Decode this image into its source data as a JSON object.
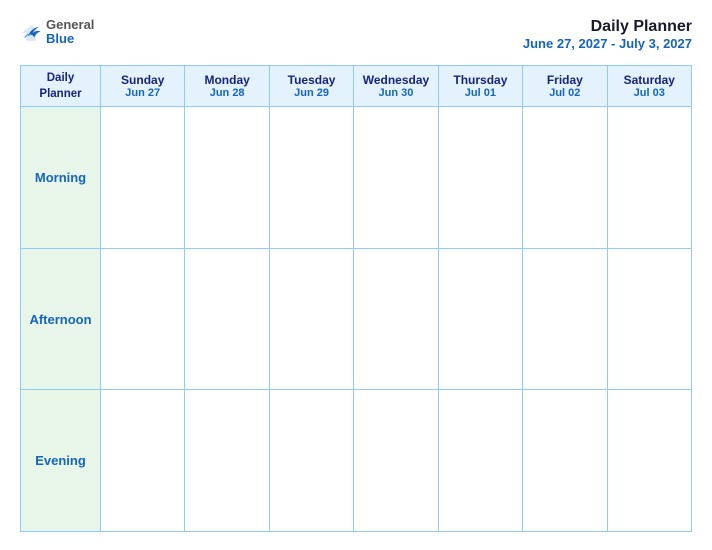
{
  "logo": {
    "general": "General",
    "blue": "Blue",
    "icon_color": "#1565c0"
  },
  "header": {
    "title": "Daily Planner",
    "dates": "June 27, 2027 - July 3, 2027"
  },
  "table": {
    "label_header": "Daily\nPlanner",
    "columns": [
      {
        "day": "Sunday",
        "date": "Jun 27"
      },
      {
        "day": "Monday",
        "date": "Jun 28"
      },
      {
        "day": "Tuesday",
        "date": "Jun 29"
      },
      {
        "day": "Wednesday",
        "date": "Jun 30"
      },
      {
        "day": "Thursday",
        "date": "Jul 01"
      },
      {
        "day": "Friday",
        "date": "Jul 02"
      },
      {
        "day": "Saturday",
        "date": "Jul 03"
      }
    ],
    "rows": [
      {
        "label": "Morning"
      },
      {
        "label": "Afternoon"
      },
      {
        "label": "Evening"
      }
    ]
  }
}
